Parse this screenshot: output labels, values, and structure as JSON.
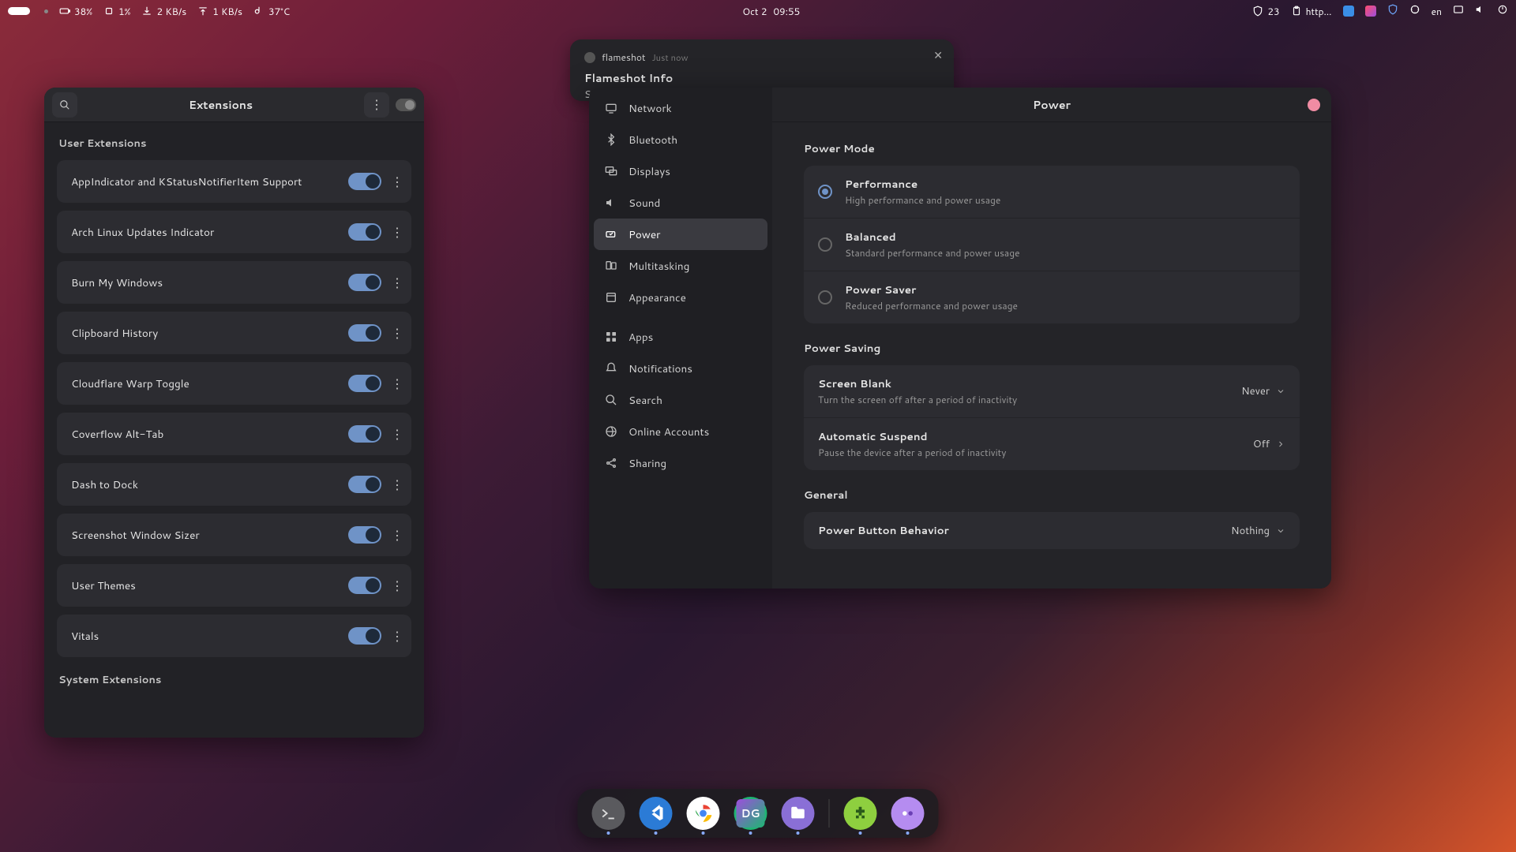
{
  "topbar": {
    "battery_pct": "38%",
    "cpu_pct": "1%",
    "net_down": "2 KB/s",
    "net_up": "1 KB/s",
    "temp": "37°C",
    "date": "Oct 2",
    "time": "09:55",
    "workspace_count": "23",
    "clip_text": "http…",
    "lang": "en"
  },
  "notification": {
    "app": "flameshot",
    "time": "Just now",
    "title": "Flameshot Info",
    "body": "Screenshot aborted."
  },
  "extensions": {
    "window_title": "Extensions",
    "sections": {
      "user": "User Extensions",
      "system": "System Extensions"
    },
    "items": [
      {
        "name": "AppIndicator and KStatusNotifierItem Support",
        "enabled": true
      },
      {
        "name": "Arch Linux Updates Indicator",
        "enabled": true
      },
      {
        "name": "Burn My Windows",
        "enabled": true
      },
      {
        "name": "Clipboard History",
        "enabled": true
      },
      {
        "name": "Cloudflare Warp Toggle",
        "enabled": true
      },
      {
        "name": "Coverflow Alt-Tab",
        "enabled": true
      },
      {
        "name": "Dash to Dock",
        "enabled": true
      },
      {
        "name": "Screenshot Window Sizer",
        "enabled": true
      },
      {
        "name": "User Themes",
        "enabled": true
      },
      {
        "name": "Vitals",
        "enabled": true
      }
    ]
  },
  "settings": {
    "page_title": "Power",
    "sidebar": [
      {
        "label": "Network",
        "icon": "display-icon"
      },
      {
        "label": "Bluetooth",
        "icon": "bluetooth-icon"
      },
      {
        "label": "Displays",
        "icon": "displays-icon"
      },
      {
        "label": "Sound",
        "icon": "sound-icon"
      },
      {
        "label": "Power",
        "icon": "power-icon",
        "active": true
      },
      {
        "label": "Multitasking",
        "icon": "multitasking-icon"
      },
      {
        "label": "Appearance",
        "icon": "appearance-icon"
      },
      {
        "label": "Apps",
        "icon": "apps-icon",
        "gap_before": true
      },
      {
        "label": "Notifications",
        "icon": "notifications-icon"
      },
      {
        "label": "Search",
        "icon": "search-icon"
      },
      {
        "label": "Online Accounts",
        "icon": "online-accounts-icon"
      },
      {
        "label": "Sharing",
        "icon": "sharing-icon"
      }
    ],
    "power_mode": {
      "section": "Power Mode",
      "options": [
        {
          "title": "Performance",
          "desc": "High performance and power usage",
          "selected": true
        },
        {
          "title": "Balanced",
          "desc": "Standard performance and power usage",
          "selected": false
        },
        {
          "title": "Power Saver",
          "desc": "Reduced performance and power usage",
          "selected": false
        }
      ]
    },
    "power_saving": {
      "section": "Power Saving",
      "rows": [
        {
          "title": "Screen Blank",
          "desc": "Turn the screen off after a period of inactivity",
          "value": "Never",
          "kind": "dropdown"
        },
        {
          "title": "Automatic Suspend",
          "desc": "Pause the device after a period of inactivity",
          "value": "Off",
          "kind": "nav"
        }
      ]
    },
    "general": {
      "section": "General",
      "rows": [
        {
          "title": "Power Button Behavior",
          "value": "Nothing",
          "kind": "dropdown"
        }
      ]
    }
  },
  "dock": {
    "items": [
      {
        "name": "terminal",
        "color": "#5a5a5e",
        "running": true
      },
      {
        "name": "vscode",
        "color": "#2b7bd6",
        "running": true
      },
      {
        "name": "chrome",
        "color": "#ffffff",
        "running": true
      },
      {
        "name": "datagrip",
        "color": "#1fb573",
        "running": true
      },
      {
        "name": "files",
        "color": "#8a6fd6",
        "running": true
      },
      {
        "name": "extensions",
        "color": "#8ecf3f",
        "running": true,
        "after_sep": true
      },
      {
        "name": "tweaks",
        "color": "#b58cf0",
        "running": true
      }
    ]
  }
}
